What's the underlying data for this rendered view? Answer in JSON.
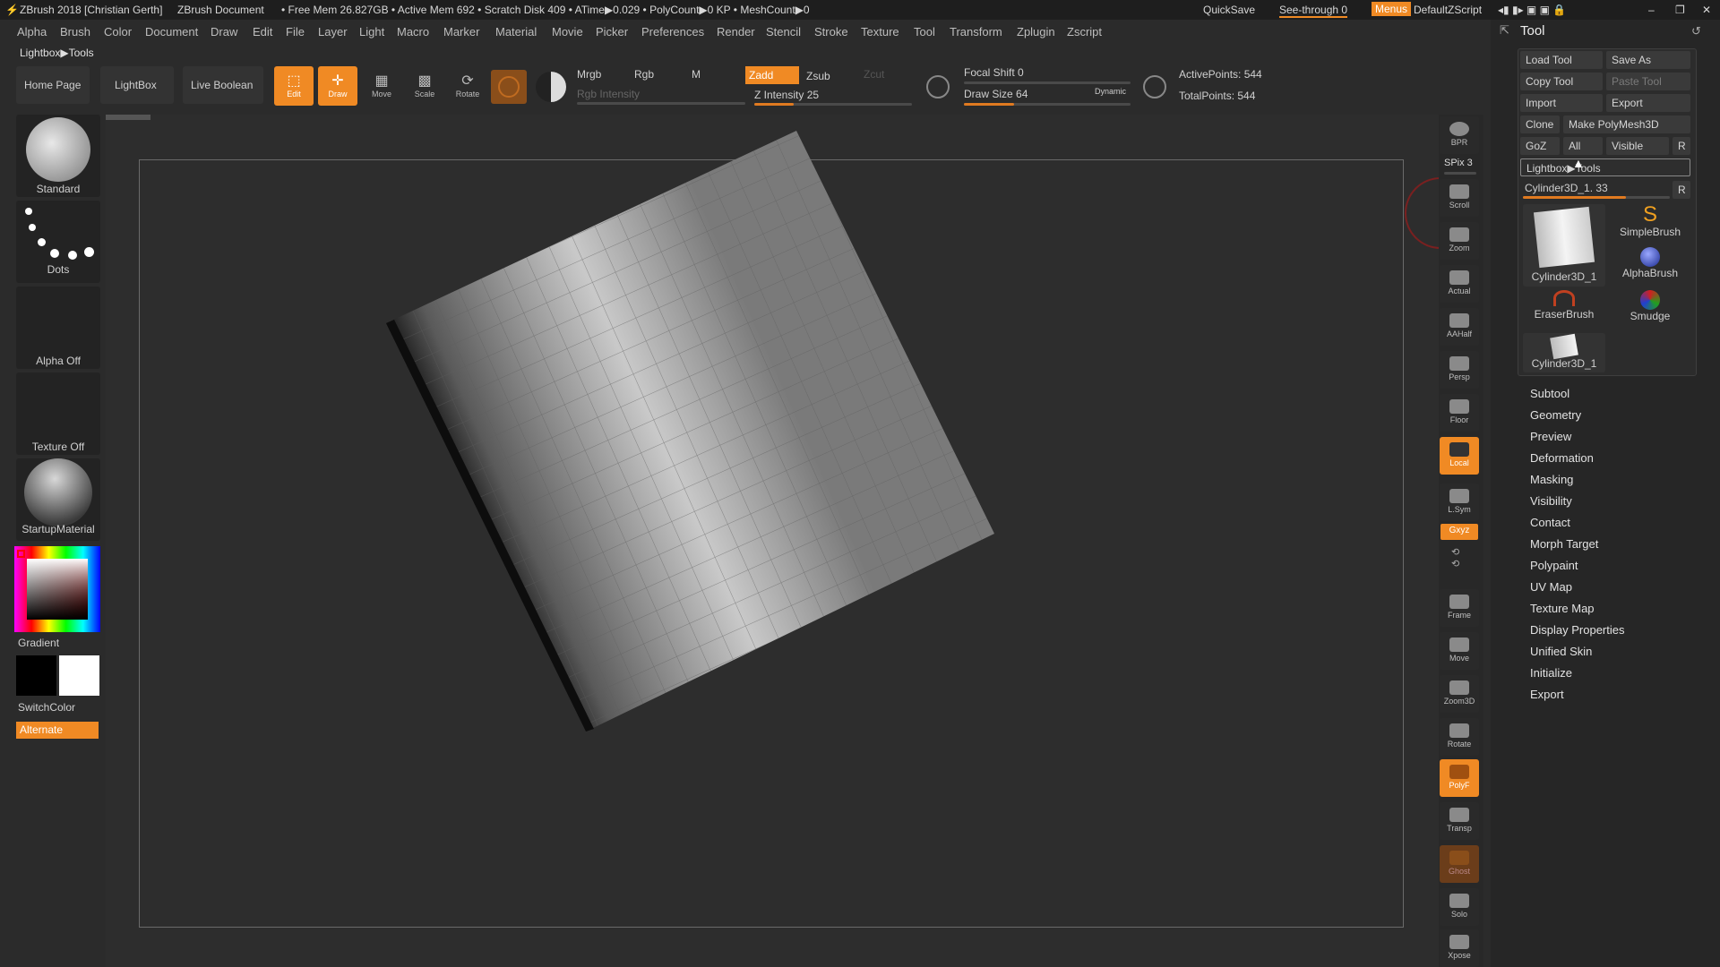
{
  "window": {
    "title": "ZBrush 2018 [Christian Gerth]",
    "document": "ZBrush Document",
    "stats": "• Free Mem 26.827GB • Active Mem 692 • Scratch Disk 409 • ATime▶0.029 • PolyCount▶0 KP • MeshCount▶0",
    "quicksave": "QuickSave",
    "see_through": "See-through  0",
    "menus": "Menus",
    "script": "DefaultZScript"
  },
  "menu": [
    "Alpha",
    "Brush",
    "Color",
    "Document",
    "Draw",
    "Edit",
    "File",
    "Layer",
    "Light",
    "Macro",
    "Marker",
    "Material",
    "Movie",
    "Picker",
    "Preferences",
    "Render",
    "Stencil",
    "Stroke",
    "Texture",
    "Tool",
    "Transform",
    "Zplugin",
    "Zscript"
  ],
  "breadcrumb": "Lightbox▶Tools",
  "toolbar": {
    "home": "Home Page",
    "lightbox": "LightBox",
    "live_boolean": "Live Boolean",
    "edit": "Edit",
    "draw": "Draw",
    "move": "Move",
    "scale": "Scale",
    "rotate": "Rotate",
    "mrgb": "Mrgb",
    "rgb": "Rgb",
    "m": "M",
    "rgb_intensity": "Rgb Intensity",
    "zadd": "Zadd",
    "zsub": "Zsub",
    "zcut": "Zcut",
    "z_intensity": "Z Intensity 25",
    "focal_shift": "Focal Shift 0",
    "draw_size": "Draw Size 64",
    "dynamic": "Dynamic",
    "active_points": "ActivePoints: 544",
    "total_points": "TotalPoints: 544",
    "z_intensity_level": 0.25,
    "draw_size_level": 0.3
  },
  "left": {
    "brush": "Standard",
    "stroke": "Dots",
    "alpha": "Alpha Off",
    "texture": "Texture Off",
    "material": "StartupMaterial",
    "gradient": "Gradient",
    "switch": "SwitchColor",
    "alternate": "Alternate"
  },
  "right_shelf": [
    "BPR",
    "Scroll",
    "Zoom",
    "Actual",
    "AAHalf",
    "Persp",
    "Floor",
    "Local",
    "L.Sym",
    "Frame",
    "Move",
    "Zoom3D",
    "Rotate",
    "PolyF",
    "Transp",
    "Ghost",
    "Solo",
    "Xpose"
  ],
  "spix": "SPix 3",
  "xyz": "Gxyz",
  "tool_panel": {
    "title": "Tool",
    "load": "Load Tool",
    "save_as": "Save As",
    "copy": "Copy Tool",
    "paste": "Paste Tool",
    "import": "Import",
    "export": "Export",
    "clone": "Clone",
    "make_poly": "Make PolyMesh3D",
    "goz": "GoZ",
    "all": "All",
    "visible": "Visible",
    "r": "R",
    "lightbox_tools": "Lightbox▶Tools",
    "current": "Cylinder3D_1. 33",
    "thumbs": [
      "Cylinder3D_1",
      "SimpleBrush",
      "AlphaBrush",
      "EraserBrush",
      "Smudge",
      "Cylinder3D_1"
    ],
    "sections": [
      "Subtool",
      "Geometry",
      "Preview",
      "Deformation",
      "Masking",
      "Visibility",
      "Contact",
      "Morph Target",
      "Polypaint",
      "UV Map",
      "Texture Map",
      "Display Properties",
      "Unified Skin",
      "Initialize",
      "Export"
    ]
  },
  "colors": {
    "accent": "#f08a24",
    "bg": "#2b2b2b"
  }
}
